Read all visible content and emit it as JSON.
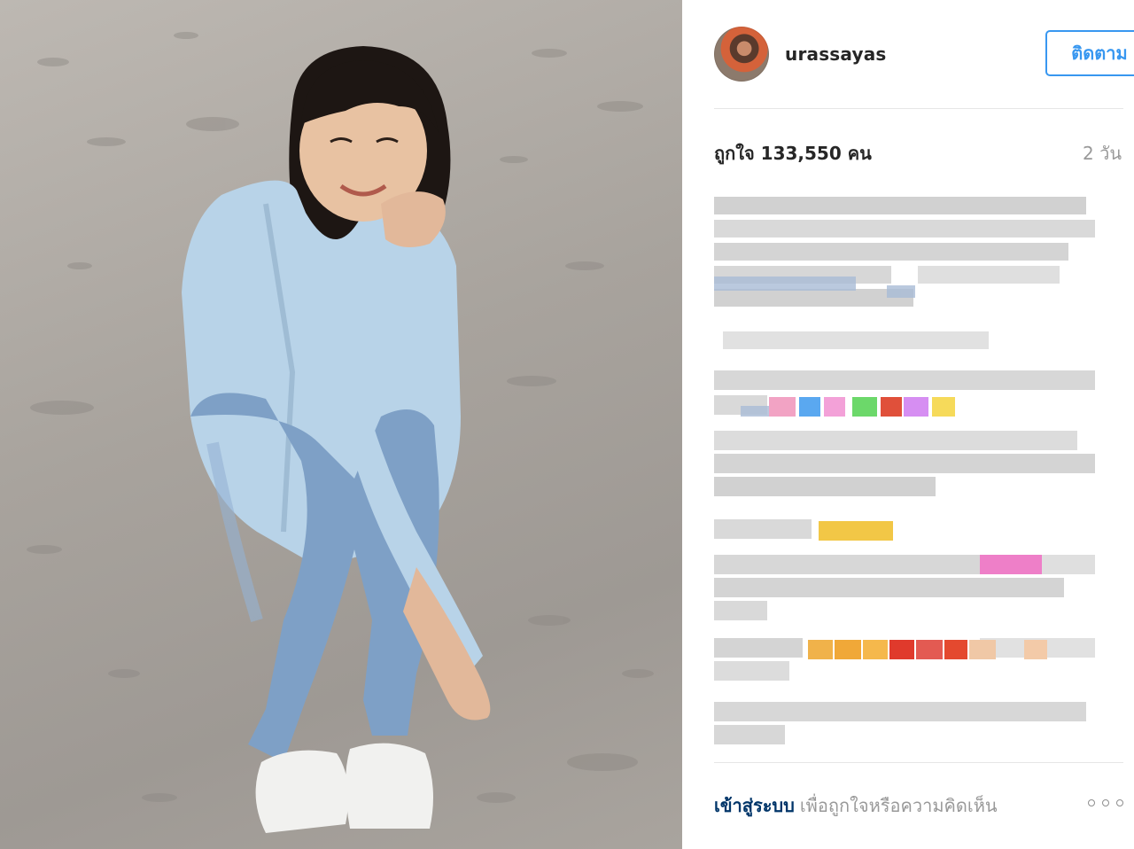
{
  "post": {
    "username": "urassayas",
    "follow_label": "ติดตาม",
    "likes_text": "ถูกใจ 133,550 คน",
    "time_ago": "2 วัน"
  },
  "footer": {
    "login_link": "เข้าสู่ระบบ",
    "login_text": "เพื่อถูกใจหรือความคิดเห็น"
  },
  "colors": {
    "accent": "#3897f0",
    "link_dark": "#003569",
    "muted": "#999999"
  },
  "icons": {
    "more": "more-options-icon"
  }
}
